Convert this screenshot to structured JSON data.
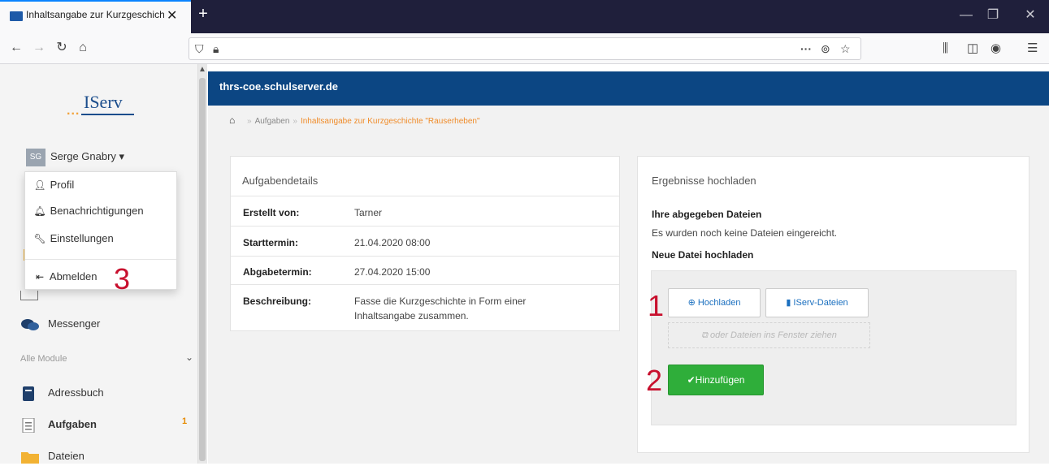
{
  "browser": {
    "tab_title": "Inhaltsangabe zur Kurzgeschichte",
    "tab_close": "✕",
    "new_tab": "+",
    "win_minimize": "—",
    "win_maximize": "❐",
    "win_close": "✕",
    "url_more": "···",
    "colors": {
      "tabbar": "#1f1f3b",
      "accent": "#0a84ff"
    }
  },
  "sidebar": {
    "logo_dots": "...",
    "logo_text": "IServ",
    "avatar_initials": "SG",
    "user_name": "Serge Gnabry ▾",
    "menu": [
      {
        "label": "Profil",
        "icon": "user-icon"
      },
      {
        "label": "Benachrichtigungen",
        "icon": "bell-icon"
      },
      {
        "label": "Einstellungen",
        "icon": "wrench-icon"
      },
      {
        "label": "Abmelden",
        "icon": "logout-icon"
      }
    ],
    "items_top": [
      {
        "label": "Messenger",
        "icon": "messenger-icon"
      }
    ],
    "section_label": "Alle Module",
    "items": [
      {
        "label": "Adressbuch",
        "icon": "addressbook-icon"
      },
      {
        "label": "Aufgaben",
        "icon": "tasks-icon",
        "badge": "1"
      },
      {
        "label": "Dateien",
        "icon": "folder-icon"
      }
    ]
  },
  "header": {
    "title": "thrs-coe.schulserver.de",
    "color": "#0c4683"
  },
  "breadcrumb": {
    "items": [
      "Aufgaben",
      "Inhaltsangabe zur Kurzgeschichte \"Rauserheben\""
    ],
    "current_color": "#f08c2a"
  },
  "details": {
    "title": "Aufgabendetails",
    "rows": [
      {
        "label": "Erstellt von:",
        "value": "Tarner"
      },
      {
        "label": "Starttermin:",
        "value": "21.04.2020 08:00"
      },
      {
        "label": "Abgabetermin:",
        "value": "27.04.2020 15:00"
      },
      {
        "label": "Beschreibung:",
        "value": "Fasse die Kurzgeschichte in Form einer",
        "value2": "Inhaltsangabe zusammen."
      }
    ]
  },
  "upload": {
    "title": "Ergebnisse hochladen",
    "files_heading": "Ihre abgegeben Dateien",
    "files_text": "Es wurden noch keine Dateien eingereicht.",
    "new_heading": "Neue Datei hochladen",
    "btn_upload": "Hochladen",
    "btn_iserv": "IServ-Dateien",
    "dropzone": "oder Dateien ins Fenster ziehen",
    "btn_add": "Hinzufügen",
    "add_color": "#2fae3a"
  },
  "annotations": [
    "1",
    "2",
    "3"
  ]
}
